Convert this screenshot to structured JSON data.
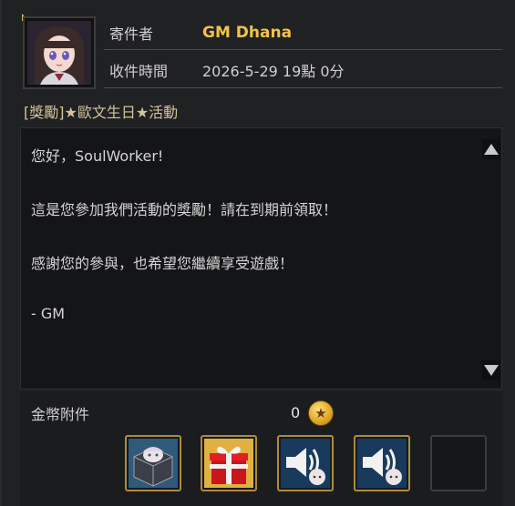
{
  "mail": {
    "sender_label": "寄件者",
    "sender": "GM Dhana",
    "received_label": "收件時間",
    "received_time": "2026-5-29 19點 0分",
    "subject": "[獎勵]★歐文生日★活動",
    "body_lines": [
      "您好，SoulWorker!",
      "這是您參加我們活動的獎勵！請在到期前領取！",
      "感謝您的參與，也希望您繼續享受遊戲！",
      "- GM"
    ]
  },
  "attachments": {
    "gold_label": "金幣附件",
    "gold_amount": "0",
    "items": [
      {
        "icon": "costume-box-icon"
      },
      {
        "icon": "gift-box-icon"
      },
      {
        "icon": "megaphone-icon"
      },
      {
        "icon": "megaphone-icon"
      }
    ]
  },
  "colors": {
    "sender": "#f0c34a",
    "subject": "#d6c39a",
    "slot_border": "#b08a3a"
  }
}
